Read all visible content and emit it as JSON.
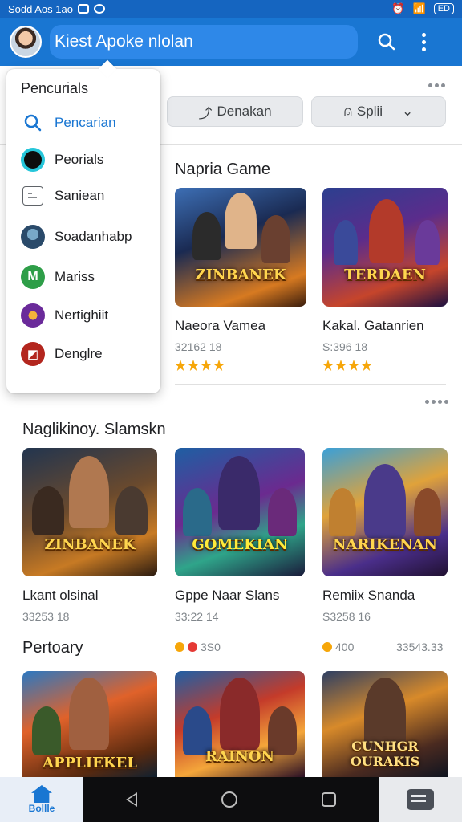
{
  "status_bar": {
    "left_text": "Sodd Aos 1ao",
    "battery": "ED"
  },
  "app_bar": {
    "search_text": "Kiest Apoke nlolan"
  },
  "filters": {
    "chip1_label": "Denakan",
    "chip2_label": "Splii"
  },
  "dropdown": {
    "title": "Pencurials",
    "items": [
      {
        "label": "Pencarian",
        "icon": "search-icon"
      },
      {
        "label": "Peorials",
        "icon": "ring-icon"
      },
      {
        "label": "Saniean",
        "icon": "document-icon"
      },
      {
        "label": "Soadanhabp",
        "icon": "avatar-icon"
      },
      {
        "label": "Mariss",
        "icon": "shield-icon"
      },
      {
        "label": "Nertighiit",
        "icon": "fire-icon"
      },
      {
        "label": "Denglre",
        "icon": "cube-icon"
      }
    ]
  },
  "sections": [
    {
      "title": "Napria Game",
      "cards": [
        {
          "name": "Naeora Vamea",
          "meta": "32162 18",
          "banner": "ZINBANEK",
          "rating": 4
        },
        {
          "name": "Kakal. Gatanrien",
          "meta": "S:396 18",
          "banner": "TERDAEN",
          "rating": 4
        }
      ]
    },
    {
      "title": "Naglikinoy. Slamskn",
      "cards": [
        {
          "name": "Lkant olsinal",
          "meta": "33253 18",
          "banner": "ZINBANEK"
        },
        {
          "name": "Gppe Naar Slans",
          "meta": "33:22 14",
          "banner": "GOMEKIAN"
        },
        {
          "name": "Remiix Snanda",
          "meta": "S3258 16",
          "banner": "NARIKENAN"
        }
      ]
    },
    {
      "title": "Pertoary",
      "info": [
        "3S0",
        "400",
        "33543.33"
      ],
      "cards": [
        {
          "banner": "APPLIEKEL"
        },
        {
          "banner": "RAINON"
        },
        {
          "banner": "CUNHGR OURAKIS"
        }
      ]
    }
  ],
  "bottom_nav": {
    "home_label": "Bollle"
  }
}
